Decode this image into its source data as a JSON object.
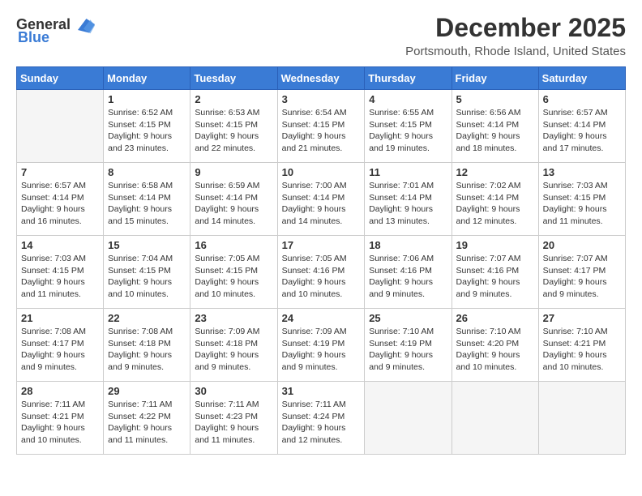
{
  "logo": {
    "general": "General",
    "blue": "Blue"
  },
  "header": {
    "month": "December 2025",
    "location": "Portsmouth, Rhode Island, United States"
  },
  "days_of_week": [
    "Sunday",
    "Monday",
    "Tuesday",
    "Wednesday",
    "Thursday",
    "Friday",
    "Saturday"
  ],
  "weeks": [
    [
      {
        "day": "",
        "info": ""
      },
      {
        "day": "1",
        "info": "Sunrise: 6:52 AM\nSunset: 4:15 PM\nDaylight: 9 hours\nand 23 minutes."
      },
      {
        "day": "2",
        "info": "Sunrise: 6:53 AM\nSunset: 4:15 PM\nDaylight: 9 hours\nand 22 minutes."
      },
      {
        "day": "3",
        "info": "Sunrise: 6:54 AM\nSunset: 4:15 PM\nDaylight: 9 hours\nand 21 minutes."
      },
      {
        "day": "4",
        "info": "Sunrise: 6:55 AM\nSunset: 4:15 PM\nDaylight: 9 hours\nand 19 minutes."
      },
      {
        "day": "5",
        "info": "Sunrise: 6:56 AM\nSunset: 4:14 PM\nDaylight: 9 hours\nand 18 minutes."
      },
      {
        "day": "6",
        "info": "Sunrise: 6:57 AM\nSunset: 4:14 PM\nDaylight: 9 hours\nand 17 minutes."
      }
    ],
    [
      {
        "day": "7",
        "info": "Sunrise: 6:57 AM\nSunset: 4:14 PM\nDaylight: 9 hours\nand 16 minutes."
      },
      {
        "day": "8",
        "info": "Sunrise: 6:58 AM\nSunset: 4:14 PM\nDaylight: 9 hours\nand 15 minutes."
      },
      {
        "day": "9",
        "info": "Sunrise: 6:59 AM\nSunset: 4:14 PM\nDaylight: 9 hours\nand 14 minutes."
      },
      {
        "day": "10",
        "info": "Sunrise: 7:00 AM\nSunset: 4:14 PM\nDaylight: 9 hours\nand 14 minutes."
      },
      {
        "day": "11",
        "info": "Sunrise: 7:01 AM\nSunset: 4:14 PM\nDaylight: 9 hours\nand 13 minutes."
      },
      {
        "day": "12",
        "info": "Sunrise: 7:02 AM\nSunset: 4:14 PM\nDaylight: 9 hours\nand 12 minutes."
      },
      {
        "day": "13",
        "info": "Sunrise: 7:03 AM\nSunset: 4:15 PM\nDaylight: 9 hours\nand 11 minutes."
      }
    ],
    [
      {
        "day": "14",
        "info": "Sunrise: 7:03 AM\nSunset: 4:15 PM\nDaylight: 9 hours\nand 11 minutes."
      },
      {
        "day": "15",
        "info": "Sunrise: 7:04 AM\nSunset: 4:15 PM\nDaylight: 9 hours\nand 10 minutes."
      },
      {
        "day": "16",
        "info": "Sunrise: 7:05 AM\nSunset: 4:15 PM\nDaylight: 9 hours\nand 10 minutes."
      },
      {
        "day": "17",
        "info": "Sunrise: 7:05 AM\nSunset: 4:16 PM\nDaylight: 9 hours\nand 10 minutes."
      },
      {
        "day": "18",
        "info": "Sunrise: 7:06 AM\nSunset: 4:16 PM\nDaylight: 9 hours\nand 9 minutes."
      },
      {
        "day": "19",
        "info": "Sunrise: 7:07 AM\nSunset: 4:16 PM\nDaylight: 9 hours\nand 9 minutes."
      },
      {
        "day": "20",
        "info": "Sunrise: 7:07 AM\nSunset: 4:17 PM\nDaylight: 9 hours\nand 9 minutes."
      }
    ],
    [
      {
        "day": "21",
        "info": "Sunrise: 7:08 AM\nSunset: 4:17 PM\nDaylight: 9 hours\nand 9 minutes."
      },
      {
        "day": "22",
        "info": "Sunrise: 7:08 AM\nSunset: 4:18 PM\nDaylight: 9 hours\nand 9 minutes."
      },
      {
        "day": "23",
        "info": "Sunrise: 7:09 AM\nSunset: 4:18 PM\nDaylight: 9 hours\nand 9 minutes."
      },
      {
        "day": "24",
        "info": "Sunrise: 7:09 AM\nSunset: 4:19 PM\nDaylight: 9 hours\nand 9 minutes."
      },
      {
        "day": "25",
        "info": "Sunrise: 7:10 AM\nSunset: 4:19 PM\nDaylight: 9 hours\nand 9 minutes."
      },
      {
        "day": "26",
        "info": "Sunrise: 7:10 AM\nSunset: 4:20 PM\nDaylight: 9 hours\nand 10 minutes."
      },
      {
        "day": "27",
        "info": "Sunrise: 7:10 AM\nSunset: 4:21 PM\nDaylight: 9 hours\nand 10 minutes."
      }
    ],
    [
      {
        "day": "28",
        "info": "Sunrise: 7:11 AM\nSunset: 4:21 PM\nDaylight: 9 hours\nand 10 minutes."
      },
      {
        "day": "29",
        "info": "Sunrise: 7:11 AM\nSunset: 4:22 PM\nDaylight: 9 hours\nand 11 minutes."
      },
      {
        "day": "30",
        "info": "Sunrise: 7:11 AM\nSunset: 4:23 PM\nDaylight: 9 hours\nand 11 minutes."
      },
      {
        "day": "31",
        "info": "Sunrise: 7:11 AM\nSunset: 4:24 PM\nDaylight: 9 hours\nand 12 minutes."
      },
      {
        "day": "",
        "info": ""
      },
      {
        "day": "",
        "info": ""
      },
      {
        "day": "",
        "info": ""
      }
    ]
  ]
}
